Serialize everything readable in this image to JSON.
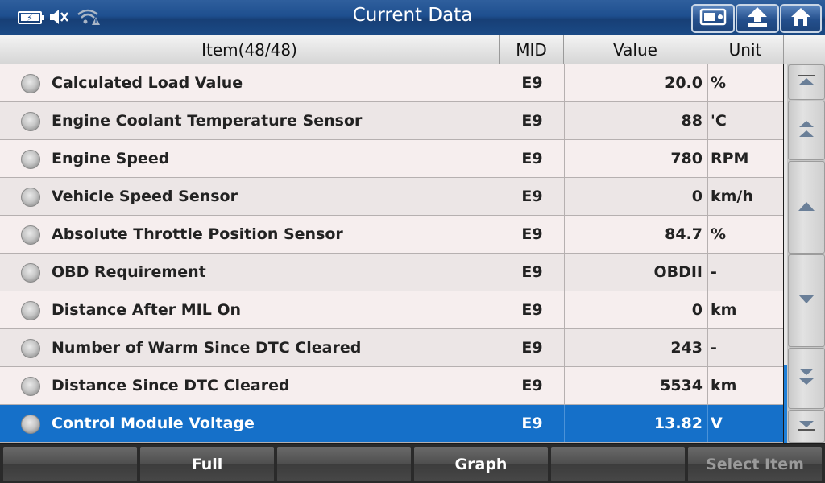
{
  "title": "Current Data",
  "header": {
    "item": "Item(48/48)",
    "mid": "MID",
    "value": "Value",
    "unit": "Unit"
  },
  "rows": [
    {
      "item": "Calculated Load Value",
      "mid": "E9",
      "value": "20.0",
      "unit": "%"
    },
    {
      "item": "Engine Coolant Temperature Sensor",
      "mid": "E9",
      "value": "88",
      "unit": "'C"
    },
    {
      "item": "Engine Speed",
      "mid": "E9",
      "value": "780",
      "unit": "RPM"
    },
    {
      "item": "Vehicle Speed Sensor",
      "mid": "E9",
      "value": "0",
      "unit": "km/h"
    },
    {
      "item": "Absolute Throttle Position Sensor",
      "mid": "E9",
      "value": "84.7",
      "unit": "%"
    },
    {
      "item": "OBD Requirement",
      "mid": "E9",
      "value": "OBDII",
      "unit": "-"
    },
    {
      "item": "Distance After MIL On",
      "mid": "E9",
      "value": "0",
      "unit": "km"
    },
    {
      "item": "Number of Warm Since DTC Cleared",
      "mid": "E9",
      "value": "243",
      "unit": "-"
    },
    {
      "item": "Distance Since DTC Cleared",
      "mid": "E9",
      "value": "5534",
      "unit": "km"
    },
    {
      "item": "Control Module Voltage",
      "mid": "E9",
      "value": "13.82",
      "unit": "V"
    }
  ],
  "toolbar": {
    "full": "Full",
    "graph": "Graph",
    "select_item": "Select Item"
  },
  "colors": {
    "titlebar": "#1e4f8f",
    "selected_row": "#1570c9",
    "scroll_thumb": "#1e7fd8"
  },
  "icons": [
    "battery-icon",
    "mute-icon",
    "wifi-warning-icon",
    "screenshot-icon",
    "back-icon",
    "home-icon"
  ]
}
